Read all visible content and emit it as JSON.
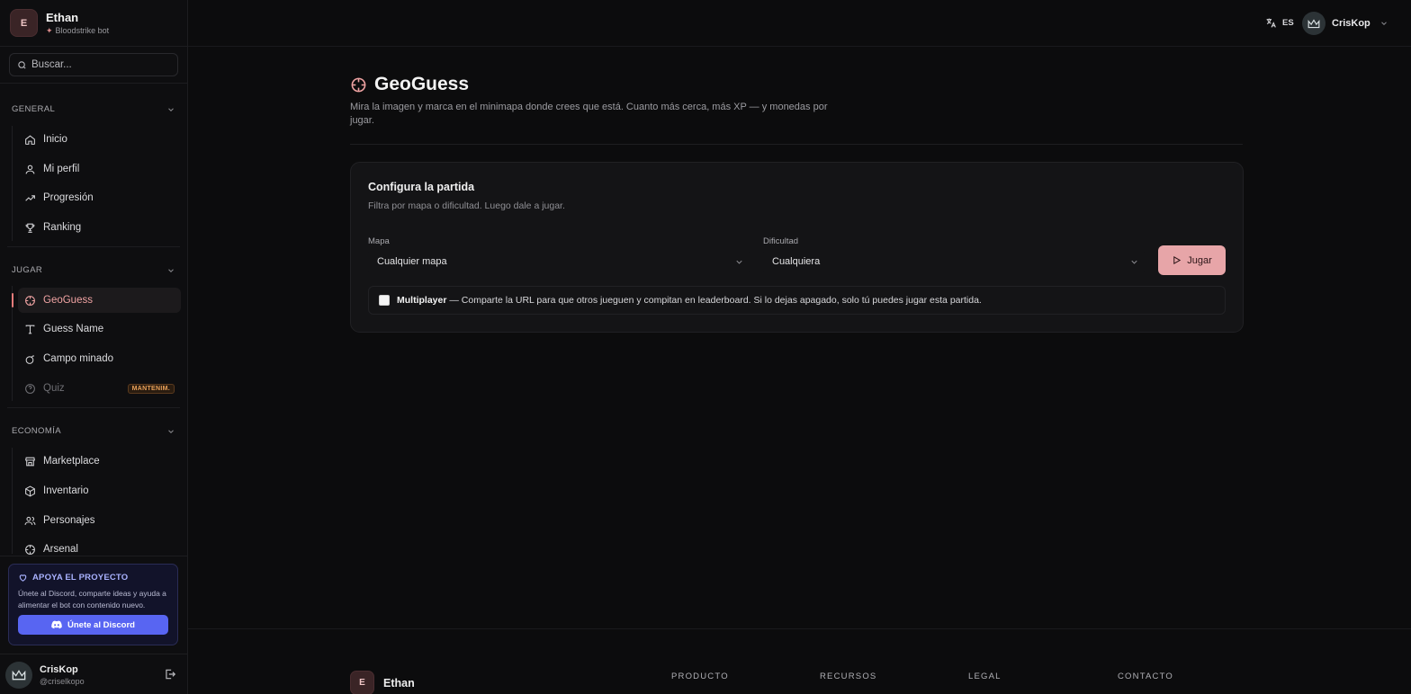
{
  "brand": {
    "initial": "E",
    "name": "Ethan",
    "subtitle": "Bloodstrike bot"
  },
  "search": {
    "placeholder": "Buscar..."
  },
  "sections": {
    "general": {
      "title": "GENERAL",
      "items": [
        {
          "label": "Inicio",
          "icon": "home-icon"
        },
        {
          "label": "Mi perfil",
          "icon": "user-icon"
        },
        {
          "label": "Progresión",
          "icon": "trending-up-icon"
        },
        {
          "label": "Ranking",
          "icon": "trophy-icon"
        }
      ]
    },
    "jugar": {
      "title": "JUGAR",
      "items": [
        {
          "label": "GeoGuess",
          "icon": "crosshair-icon",
          "active": true
        },
        {
          "label": "Guess Name",
          "icon": "type-icon"
        },
        {
          "label": "Campo minado",
          "icon": "bomb-icon"
        },
        {
          "label": "Quiz",
          "icon": "help-circle-icon",
          "badge": "MANTENIM.",
          "disabled": true
        }
      ]
    },
    "economia": {
      "title": "ECONOMÍA",
      "items": [
        {
          "label": "Marketplace",
          "icon": "store-icon"
        },
        {
          "label": "Inventario",
          "icon": "box-icon"
        },
        {
          "label": "Personajes",
          "icon": "users-icon"
        },
        {
          "label": "Arsenal",
          "icon": "crosshair-icon"
        }
      ]
    }
  },
  "support": {
    "title": "APOYA EL PROYECTO",
    "text": "Únete al Discord, comparte ideas y ayuda a alimentar el bot con contenido nuevo.",
    "button": "Únete al Discord"
  },
  "user": {
    "name": "CrisKop",
    "handle": "@criselkopo"
  },
  "topbar": {
    "language": "ES",
    "username": "CrisKop"
  },
  "page": {
    "title": "GeoGuess",
    "description": "Mira la imagen y marca en el minimapa donde crees que está. Cuanto más cerca, más XP — y monedas por jugar."
  },
  "config": {
    "title": "Configura la partida",
    "subtitle": "Filtra por mapa o dificultad. Luego dale a jugar.",
    "map_label": "Mapa",
    "map_value": "Cualquier mapa",
    "difficulty_label": "Dificultad",
    "difficulty_value": "Cualquiera",
    "play_button": "Jugar",
    "multiplayer_label": "Multiplayer",
    "multiplayer_text": "— Comparte la URL para que otros jueguen y compitan en leaderboard. Si lo dejas apagado, solo tú puedes jugar esta partida.",
    "multiplayer_checked": false
  },
  "footer": {
    "brand_initial": "E",
    "brand_name": "Ethan",
    "columns": [
      "PRODUCTO",
      "RECURSOS",
      "LEGAL",
      "CONTACTO"
    ]
  },
  "colors": {
    "accent": "#e7a5a8",
    "active_text": "#f0a3a3",
    "discord": "#5865f2",
    "badge": "#e8a15a"
  }
}
